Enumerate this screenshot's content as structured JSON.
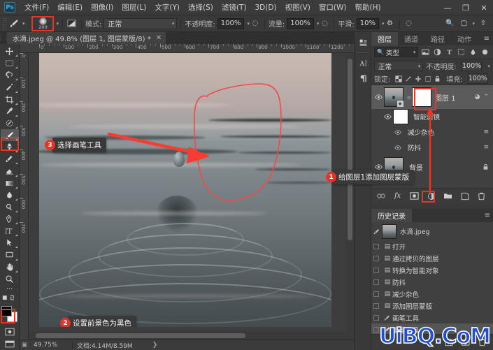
{
  "app": {
    "logo": "Ps",
    "menus": [
      "文件(F)",
      "编辑(E)",
      "图像(I)",
      "图层(L)",
      "文字(Y)",
      "选择(S)",
      "滤镜(T)",
      "3D(D)",
      "视图(V)",
      "窗口(W)",
      "帮助(H)"
    ],
    "window_buttons": [
      {
        "name": "minimize",
        "glyph": "—"
      },
      {
        "name": "restore",
        "glyph": "❐"
      },
      {
        "name": "close",
        "glyph": "✕"
      }
    ]
  },
  "options_bar": {
    "tool_icon": "brush-icon",
    "brush_size": "200",
    "mode_label": "模式:",
    "mode_value": "正常",
    "opacity_label": "不透明度:",
    "opacity_value": "100%",
    "flow_label": "流量:",
    "flow_value": "100%",
    "smoothing_label": "平滑:",
    "smoothing_value": "10%",
    "right_icons": [
      "search-icon",
      "workspace-icon",
      "share-icon"
    ]
  },
  "document_tab": {
    "title": "水滴.jpeg @ 49.8% (图层 1, 图层蒙版/8) *",
    "close": "✕"
  },
  "toolbar": {
    "tools": [
      {
        "name": "move-tool",
        "glyph": "✥",
        "selected": false
      },
      {
        "name": "marquee-tool",
        "glyph": "▭",
        "selected": false
      },
      {
        "name": "lasso-tool",
        "glyph": "◠",
        "selected": false
      },
      {
        "name": "quick-select-tool",
        "glyph": "✧",
        "selected": false
      },
      {
        "name": "crop-tool",
        "glyph": "⌗",
        "selected": false
      },
      {
        "name": "eyedropper-tool",
        "glyph": "⚲",
        "selected": false
      },
      {
        "name": "spot-healing-tool",
        "glyph": "⊛",
        "selected": false
      },
      {
        "name": "brush-tool",
        "glyph": "✎",
        "selected": true
      },
      {
        "name": "clone-stamp-tool",
        "glyph": "⎈",
        "selected": false
      },
      {
        "name": "history-brush-tool",
        "glyph": "✐",
        "selected": false
      },
      {
        "name": "eraser-tool",
        "glyph": "◣",
        "selected": false
      },
      {
        "name": "gradient-tool",
        "glyph": "▬",
        "selected": false
      },
      {
        "name": "blur-tool",
        "glyph": "💧",
        "selected": false
      },
      {
        "name": "dodge-tool",
        "glyph": "⚭",
        "selected": false
      },
      {
        "name": "pen-tool",
        "glyph": "✒",
        "selected": false
      },
      {
        "name": "type-tool",
        "glyph": "T",
        "selected": false
      },
      {
        "name": "path-selection-tool",
        "glyph": "➤",
        "selected": false
      },
      {
        "name": "shape-tool",
        "glyph": "▰",
        "selected": false
      },
      {
        "name": "hand-tool",
        "glyph": "✋",
        "selected": false
      },
      {
        "name": "zoom-tool",
        "glyph": "🔍",
        "selected": false
      },
      {
        "name": "edit-toolbar",
        "glyph": "···",
        "selected": false
      }
    ],
    "foreground_color": "#000000",
    "background_color": "#ffffff"
  },
  "canvas": {
    "ruler_labels": [
      "0",
      "100",
      "200",
      "300",
      "400",
      "500",
      "600",
      "700",
      "800",
      "900",
      "1000",
      "1100",
      "1200"
    ],
    "ruler_v_labels": [
      "0",
      "100",
      "200",
      "300",
      "400",
      "500",
      "600",
      "700"
    ]
  },
  "status_bar": {
    "zoom": "49.75%",
    "doc_info": "文档:4.14M/8.59M",
    "arrow": "❯"
  },
  "mini_dock": {
    "icons": [
      "properties-icon",
      "character-icon",
      "paragraph-icon"
    ]
  },
  "layers_panel": {
    "tabs": [
      {
        "label": "图层",
        "active": true
      },
      {
        "label": "通道",
        "active": false
      },
      {
        "label": "路径",
        "active": false
      },
      {
        "label": "动作",
        "active": false
      }
    ],
    "menu_icon": "panel-menu-icon",
    "filter_label": "类型",
    "filter_icons": [
      "image-filter-icon",
      "adjustment-filter-icon",
      "type-filter-icon",
      "shape-filter-icon",
      "smart-filter-icon"
    ],
    "blend_mode": "正常",
    "opacity_label": "不透明度:",
    "opacity_value": "100%",
    "lock_label": "锁定:",
    "lock_icons": [
      "lock-transparency-icon",
      "lock-image-icon",
      "lock-position-icon",
      "lock-artboard-icon",
      "lock-all-icon"
    ],
    "fill_label": "填充:",
    "fill_value": "100%",
    "rows": [
      {
        "name": "图层 1",
        "type": "smart-object",
        "visible": true,
        "selected": true,
        "has_mask": true,
        "right_icon": "smart-filter-icon",
        "collapse": "⌃"
      },
      {
        "name": "智能滤镜",
        "type": "smart-filter-group",
        "visible": true,
        "indent": 1
      },
      {
        "name": "减少杂色",
        "type": "filter",
        "visible": true,
        "indent": 2,
        "right_icon": "≡"
      },
      {
        "name": "防抖",
        "type": "filter",
        "visible": true,
        "indent": 2,
        "right_icon": "≡"
      },
      {
        "name": "背景",
        "type": "background",
        "visible": true,
        "locked": true
      }
    ],
    "footer_icons": [
      "link-layers-icon",
      "layer-style-fx-icon",
      "add-layer-mask-icon",
      "adjustment-layer-icon",
      "new-group-icon",
      "new-layer-icon",
      "delete-layer-icon"
    ]
  },
  "history_panel": {
    "tab": "历史记录",
    "menu_icon": "panel-menu-icon",
    "snapshot": {
      "name": "水滴.jpeg"
    },
    "states": [
      {
        "label": "打开",
        "selected": false
      },
      {
        "label": "通过拷贝的图层",
        "selected": false
      },
      {
        "label": "转换为智能对象",
        "selected": false
      },
      {
        "label": "防抖",
        "selected": false
      },
      {
        "label": "减少杂色",
        "selected": false
      },
      {
        "label": "添加图层蒙版",
        "selected": false
      },
      {
        "label": "画笔工具",
        "selected": false
      },
      {
        "label": "画笔工具",
        "selected": true
      }
    ],
    "footer_icons": [
      "new-document-icon",
      "new-snapshot-icon",
      "delete-state-icon"
    ]
  },
  "annotations": [
    {
      "number": "1",
      "text": "给图层1添加图层蒙版"
    },
    {
      "number": "2",
      "text": "设置前景色为黑色"
    },
    {
      "number": "3",
      "text": "选择画笔工具"
    }
  ],
  "watermark": "UiBQ.CoM",
  "colors": {
    "accent_red": "#e63327",
    "panel_bg": "#393939",
    "canvas_bg": "#3d3d3d"
  }
}
